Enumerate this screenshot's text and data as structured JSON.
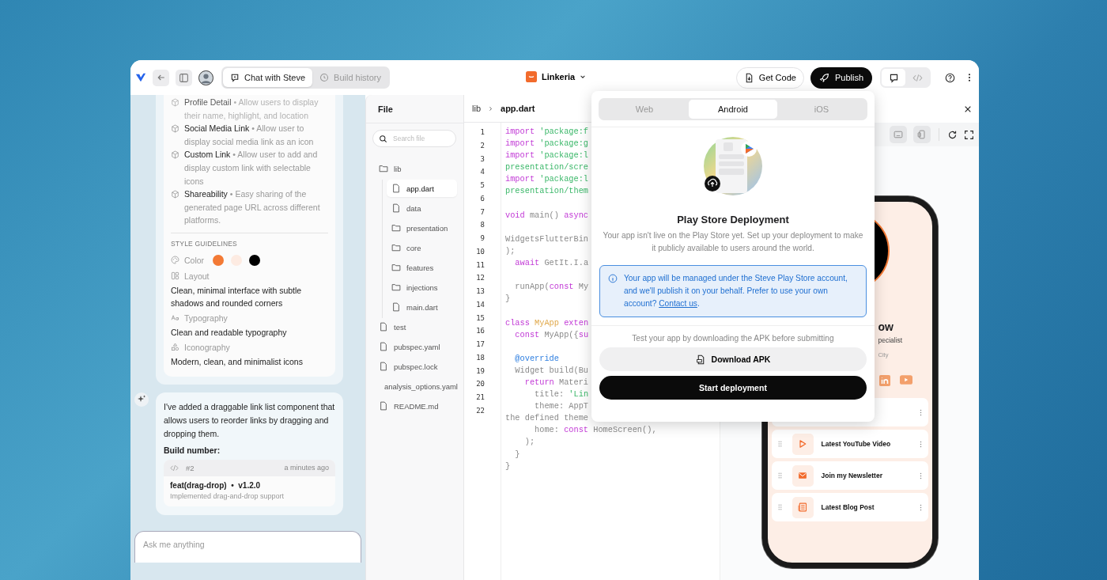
{
  "topbar": {
    "tabs": [
      {
        "label": "Chat with Steve",
        "selected": true
      },
      {
        "label": "Build history",
        "selected": false
      }
    ],
    "project": "Linkeria",
    "get_code": "Get Code",
    "publish": "Publish",
    "view_toggle": [
      {
        "selected": true
      },
      {
        "selected": false
      }
    ]
  },
  "chat": {
    "features": [
      {
        "name": "Profile Detail",
        "desc": "• Allow users to display their name, highlight, and location"
      },
      {
        "name": "Social Media Link",
        "desc": "• Allow user to display social media link as an icon"
      },
      {
        "name": "Custom Link",
        "desc": "• Allow user to add and display custom link with selectable icons"
      },
      {
        "name": "Shareability",
        "desc": "• Easy sharing of the generated page URL across different platforms."
      }
    ],
    "style_heading": "STYLE GUIDELINES",
    "color_label": "Color",
    "swatches": [
      {
        "color": "#f37a35"
      },
      {
        "color": "#fdebe2"
      },
      {
        "color": "#000000"
      }
    ],
    "guidelines": [
      {
        "label": "Layout",
        "text": "Clean, minimal interface with subtle shadows and rounded corners"
      },
      {
        "label": "Typography",
        "text": "Clean and readable typography"
      },
      {
        "label": "Iconography",
        "text": "Modern, clean, and minimalist icons"
      }
    ],
    "message": "I've added a draggable link list component that allows users to reorder links by dragging and dropping them.",
    "build_label": "Build number:",
    "build": {
      "number": "#2",
      "time": "a minutes ago",
      "title": "feat(drag-drop)  •  v1.2.0",
      "desc": "Implemented drag-and-drop support"
    },
    "input_placeholder": "Ask me anything"
  },
  "files": {
    "title": "File",
    "search_placeholder": "Search file",
    "tree": [
      {
        "name": "lib",
        "kind": "folder",
        "selected": false,
        "children": [
          {
            "name": "app.dart",
            "kind": "file",
            "selected": true
          },
          {
            "name": "data",
            "kind": "file",
            "selected": false
          },
          {
            "name": "presentation",
            "kind": "folder",
            "selected": false
          },
          {
            "name": "core",
            "kind": "folder",
            "selected": false
          },
          {
            "name": "features",
            "kind": "folder",
            "selected": false
          },
          {
            "name": "injections",
            "kind": "folder",
            "selected": false
          },
          {
            "name": "main.dart",
            "kind": "file",
            "selected": false
          }
        ]
      },
      {
        "name": "test",
        "kind": "file",
        "selected": false
      },
      {
        "name": "pubspec.yaml",
        "kind": "file",
        "selected": false
      },
      {
        "name": "pubspec.lock",
        "kind": "file",
        "selected": false
      },
      {
        "name": "analysis_options.yaml",
        "kind": "file",
        "selected": false
      },
      {
        "name": "README.md",
        "kind": "file",
        "selected": false
      }
    ]
  },
  "editor": {
    "breadcrumb": [
      "lib",
      "app.dart"
    ],
    "line_numbers": [
      "1",
      "2",
      "3",
      "4",
      "5",
      "6",
      "7",
      "8",
      "9",
      "10",
      "11",
      "12",
      "13",
      "14",
      "15",
      "16",
      "17",
      "18",
      "19",
      "20",
      "21",
      "22"
    ],
    "blocks": [
      {
        "lines": [
          {
            "tokens": [
              {
                "kind": "kw",
                "text": "import"
              },
              {
                "kind": "str",
                "text": " 'package:f"
              }
            ]
          },
          {
            "tokens": [
              {
                "kind": "kw",
                "text": "import"
              },
              {
                "kind": "str",
                "text": " 'package:g"
              }
            ]
          },
          {
            "tokens": [
              {
                "kind": "kw",
                "text": "import"
              },
              {
                "kind": "str",
                "text": " 'package:l"
              }
            ]
          },
          {
            "tokens": [
              {
                "kind": "str",
                "text": "presentation/scre"
              }
            ]
          },
          {
            "tokens": [
              {
                "kind": "kw",
                "text": "import"
              },
              {
                "kind": "str",
                "text": " 'package:l"
              }
            ]
          },
          {
            "tokens": [
              {
                "kind": "str",
                "text": "presentation/them"
              }
            ]
          }
        ]
      },
      {
        "lines": [
          {
            "tokens": [
              {
                "kind": "kw",
                "text": "void"
              },
              {
                "kind": "pl",
                "text": " main() "
              },
              {
                "kind": "kw",
                "text": "async"
              }
            ]
          }
        ]
      },
      {
        "lines": [
          {
            "tokens": [
              {
                "kind": "pl",
                "text": "WidgetsFlutterBin"
              }
            ]
          },
          {
            "tokens": [
              {
                "kind": "pl",
                "text": ");"
              }
            ]
          },
          {
            "tokens": [
              {
                "kind": "kw",
                "text": "  await"
              },
              {
                "kind": "pl",
                "text": " GetIt.I.a"
              }
            ]
          }
        ]
      },
      {
        "lines": [
          {
            "tokens": [
              {
                "kind": "pl",
                "text": "  runApp("
              },
              {
                "kind": "kw",
                "text": "const"
              },
              {
                "kind": "pl",
                "text": " My"
              }
            ]
          },
          {
            "tokens": [
              {
                "kind": "pl",
                "text": "}"
              }
            ]
          }
        ]
      },
      {
        "lines": [
          {
            "tokens": [
              {
                "kind": "kw",
                "text": "class "
              },
              {
                "kind": "type",
                "text": "MyApp"
              },
              {
                "kind": "kw",
                "text": " exten"
              }
            ]
          },
          {
            "tokens": [
              {
                "kind": "kw",
                "text": "  const"
              },
              {
                "kind": "pl",
                "text": " MyApp({"
              },
              {
                "kind": "kw",
                "text": "su"
              }
            ]
          }
        ]
      },
      {
        "lines": [
          {
            "tokens": [
              {
                "kind": "ann",
                "text": "  @override"
              }
            ]
          },
          {
            "tokens": [
              {
                "kind": "pl",
                "text": "  Widget build(Bu"
              }
            ]
          },
          {
            "tokens": [
              {
                "kind": "kw",
                "text": "    return"
              },
              {
                "kind": "pl",
                "text": " Materi"
              }
            ]
          },
          {
            "tokens": [
              {
                "kind": "pl",
                "text": "      title: "
              },
              {
                "kind": "str",
                "text": "'Lin"
              }
            ]
          },
          {
            "tokens": [
              {
                "kind": "pl",
                "text": "      theme: AppT"
              }
            ]
          },
          {
            "tokens": [
              {
                "kind": "pl",
                "text": "the defined theme"
              }
            ]
          },
          {
            "tokens": [
              {
                "kind": "pl",
                "text": "      home: "
              },
              {
                "kind": "kw",
                "text": "const"
              },
              {
                "kind": "pl",
                "text": " HomeScreen(),"
              }
            ]
          },
          {
            "tokens": [
              {
                "kind": "pl",
                "text": "    );"
              }
            ]
          },
          {
            "tokens": [
              {
                "kind": "pl",
                "text": "  }"
              }
            ]
          },
          {
            "tokens": [
              {
                "kind": "pl",
                "text": "}"
              }
            ]
          }
        ]
      }
    ]
  },
  "deploy": {
    "tabs": [
      {
        "label": "Web",
        "selected": false
      },
      {
        "label": "Android",
        "selected": true
      },
      {
        "label": "iOS",
        "selected": false
      }
    ],
    "title": "Play Store Deployment",
    "description": "Your app isn't live on the Play Store yet. Set up your deployment to make it publicly available to users around the world.",
    "notice": "Your app will be managed under the Steve Play Store account, and we'll publish it on your behalf. Prefer to use your own account?",
    "notice_link": "Contact us",
    "notice_end": ".",
    "test_hint": "Test your app by downloading the APK before submitting",
    "download": "Download APK",
    "start": "Start deployment"
  },
  "preview": {
    "name": "ow",
    "role": "pecialist",
    "location": "City",
    "links": [
      {
        "covered": true
      },
      {
        "covered": false,
        "kind": "video",
        "label": "Latest YouTube Video"
      },
      {
        "covered": false,
        "kind": "mail",
        "label": "Join my Newsletter"
      },
      {
        "covered": false,
        "kind": "blog",
        "label": "Latest Blog Post"
      }
    ]
  }
}
